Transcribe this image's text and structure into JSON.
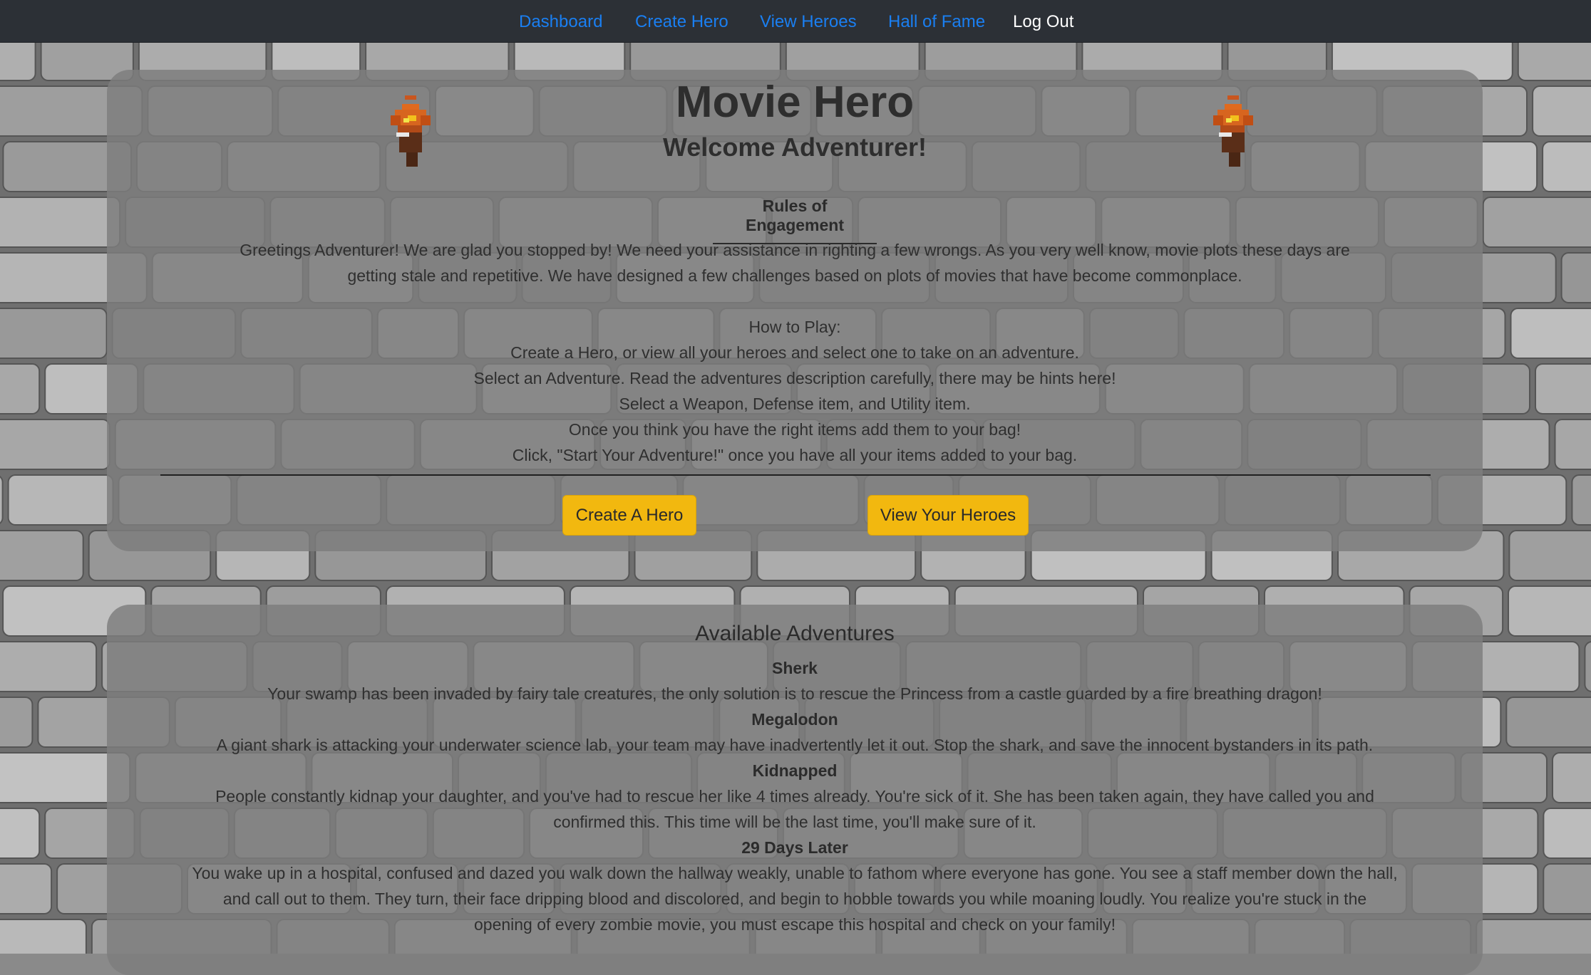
{
  "nav": {
    "items": [
      {
        "label": "Dashboard"
      },
      {
        "label": "Create Hero"
      },
      {
        "label": "View Heroes"
      },
      {
        "label": "Hall of Fame"
      },
      {
        "label": "Log Out"
      }
    ],
    "link_color": "#1a7ff2"
  },
  "hero": {
    "title": "Movie Hero",
    "subtitle": "Welcome Adventurer!",
    "rules_heading": "Rules of Engagement",
    "intro_line1": "Greetings Adventurer! We are glad you stopped by! We need your assistance in righting a few wrongs. As you very well know, movie plots these days are",
    "intro_line2": "getting stale and repetitive. We have designed a few challenges based on plots of movies that have become commonplace.",
    "how_to_play": "How to Play:",
    "steps": [
      "Create a Hero, or view all your heroes and select one to take on an adventure.",
      "Select an Adventure. Read the adventures description carefully, there may be hints here!",
      "Select a Weapon, Defense item, and Utility item.",
      "Once you think you have the right items add them to your bag!",
      "Click, \"Start Your Adventure!\" once you have all your items added to your bag."
    ],
    "buttons": {
      "create": "Create A Hero",
      "view": "View Your Heroes"
    },
    "button_color": "#f2b80f",
    "icons": [
      "torch-icon",
      "torch-icon"
    ]
  },
  "adventures": {
    "heading": "Available Adventures",
    "items": [
      {
        "name": "Sherk",
        "desc": [
          "Your swamp has been invaded by fairy tale creatures, the only solution is to rescue the Princess from a castle guarded by a fire breathing dragon!"
        ]
      },
      {
        "name": "Megalodon",
        "desc": [
          "A giant shark is attacking your underwater science lab, your team may have inadvertently let it out. Stop the shark, and save the innocent bystanders in its path."
        ]
      },
      {
        "name": "Kidnapped",
        "desc": [
          "People constantly kidnap your daughter, and you've had to rescue her like 4 times already. You're sick of it. She has been taken again, they have called you and",
          "confirmed this. This time will be the last time, you'll make sure of it."
        ]
      },
      {
        "name": "29 Days Later",
        "desc": [
          "You wake up in a hospital, confused and dazed you walk down the hallway weakly, unable to fathom where everyone has gone. You see a staff member down the hall,",
          "and call out to them. They turn, their face dripping blood and discolored, and begin to hobble towards you while moaning loudly. You realize you're stuck in the",
          "opening of every zombie movie, you must escape this hospital and check on your family!"
        ]
      }
    ]
  }
}
